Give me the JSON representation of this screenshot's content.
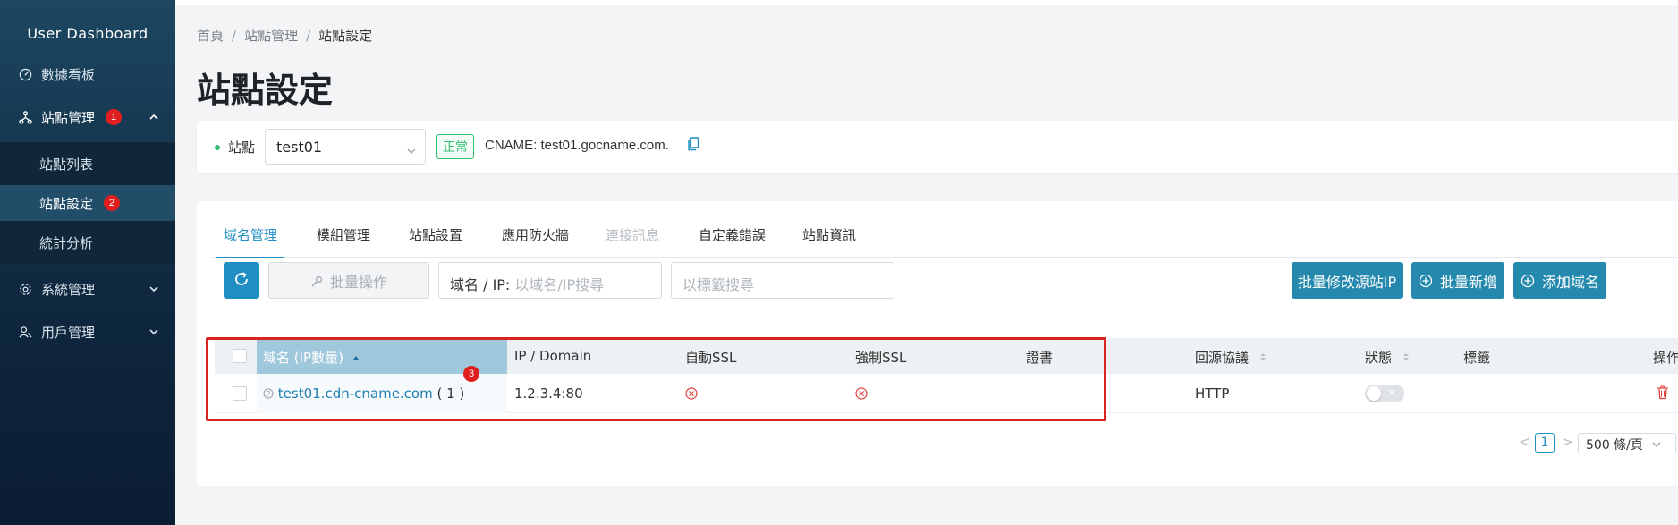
{
  "sidebar": {
    "title": "User Dashboard",
    "items": [
      {
        "label": "數據看板",
        "icon": "dashboard-icon"
      },
      {
        "label": "站點管理",
        "icon": "sitemap-icon",
        "badge": "1"
      },
      {
        "label": "站點列表"
      },
      {
        "label": "站點設定",
        "badge": "2"
      },
      {
        "label": "統計分析"
      },
      {
        "label": "系統管理",
        "icon": "gear-icon"
      },
      {
        "label": "用戶管理",
        "icon": "users-icon"
      }
    ]
  },
  "breadcrumb": [
    "首頁",
    "站點管理",
    "站點設定"
  ],
  "breadcrumb_sep": "/",
  "page_title": "站點設定",
  "site": {
    "label": "站點",
    "selected": "test01",
    "status": "正常",
    "cname": "CNAME: test01.gocname.com."
  },
  "tabs": [
    {
      "label": "域名管理",
      "active": true
    },
    {
      "label": "模組管理"
    },
    {
      "label": "站點設置"
    },
    {
      "label": "應用防火牆"
    },
    {
      "label": "連接訊息",
      "disabled": true
    },
    {
      "label": "自定義錯誤"
    },
    {
      "label": "站點資訊"
    }
  ],
  "toolbar": {
    "batch_op": "批量操作",
    "search_prefix": "域名 / IP:",
    "search_placeholder": "以域名/IP搜尋",
    "tag_placeholder": "以標籤搜尋",
    "btn_batch_source_ip": "批量修改源站IP",
    "btn_batch_add": "批量新增",
    "btn_add_domain": "添加域名"
  },
  "table": {
    "headers": [
      "域名 (IP數量)",
      "IP / Domain",
      "自動SSL",
      "強制SSL",
      "證書",
      "回源協議",
      "狀態",
      "標籤",
      "操作"
    ],
    "rows": [
      {
        "domain": "test01.cdn-cname.com",
        "count": "( 1 )",
        "ip": "1.2.3.4:80",
        "cert": "",
        "protocol": "HTTP",
        "tag": ""
      }
    ]
  },
  "annotation_badge": "3",
  "pagination": {
    "prev": "<",
    "page": "1",
    "next": ">",
    "page_size": "500 條/頁"
  },
  "colors": {
    "accent": "#1f8ec2",
    "badge": "#e02020",
    "success": "#2fbf71",
    "danger": "#d9241f"
  }
}
